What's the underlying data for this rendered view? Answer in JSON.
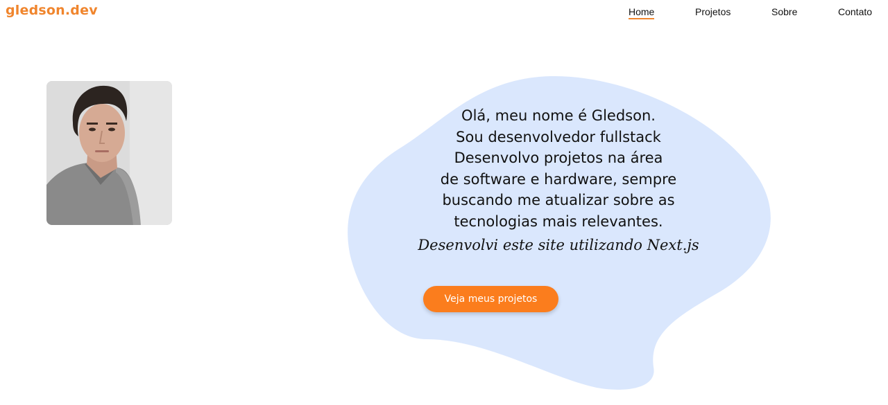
{
  "brand": {
    "logo_text": "gledson.dev",
    "accent_color": "#f0852d",
    "button_color": "#fb7d1d",
    "blob_color": "#dae7fd"
  },
  "nav": {
    "items": [
      {
        "label": "Home",
        "active": true
      },
      {
        "label": "Projetos",
        "active": false
      },
      {
        "label": "Sobre",
        "active": false
      },
      {
        "label": "Contato",
        "active": false
      }
    ]
  },
  "profile": {
    "photo_alt": "foto-perfil"
  },
  "hero": {
    "lines": [
      "Olá, meu nome é Gledson.",
      "Sou desenvolvedor fullstack",
      "Desenvolvo projetos na área",
      "de software e hardware, sempre",
      "buscando me atualizar sobre as",
      "tecnologias mais relevantes."
    ],
    "note": "Desenvolvi este site utilizando Next.js",
    "cta_label": "Veja meus projetos"
  }
}
